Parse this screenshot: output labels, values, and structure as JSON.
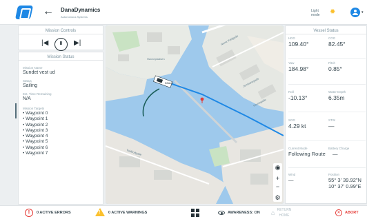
{
  "header": {
    "title": "DanaDynamics",
    "subtitle": "Autonomous Systems",
    "theme_label": "Light mode",
    "icons": {
      "logo": "logo-icon",
      "back": "arrow-left-icon",
      "theme": "sun-icon",
      "account": "account-circle-icon"
    }
  },
  "mission_controls": {
    "title": "Mission Controls",
    "icons": [
      "skip-previous-icon",
      "pause-icon",
      "skip-next-icon"
    ]
  },
  "mission_status": {
    "title": "Mission Status",
    "name_label": "Mission Name",
    "name_value": "Sundet vest ud",
    "status_label": "Status",
    "status_value": "Sailing",
    "time_label": "Est. Time Remaining",
    "time_value": "N/A",
    "targets_label": "Mission Targets",
    "targets": [
      "Waypoint 0",
      "Waypoint 1",
      "Waypoint 2",
      "Waypoint 3",
      "Waypoint 4",
      "Waypoint 5",
      "Waypoint 6",
      "Waypoint 7"
    ]
  },
  "map": {
    "vessel_label": "DNAC",
    "street_labels": [
      "Norre Voldgade",
      "Jernbanegade",
      "Havnepladsen",
      "Havnegade",
      "Toldbodgade"
    ],
    "controls": [
      "crosshair-icon",
      "zoom-in-icon",
      "zoom-out-icon",
      "settings-icon"
    ],
    "zoom_in": "+",
    "zoom_out": "−"
  },
  "vessel_status": {
    "title": "Vessel Status",
    "hdg_label": "HDG",
    "hdg_value": "109.40°",
    "cog_label": "COG",
    "cog_value": "82.45°",
    "yaw_label": "Yaw",
    "yaw_value": "184.98°",
    "pitch_label": "Pitch",
    "pitch_value": "0.85°",
    "roll_label": "Roll",
    "roll_value": "-10.13°",
    "depth_label": "Water Depth",
    "depth_value": "6.35m",
    "sog_label": "SOG",
    "sog_value": "4.29 kt",
    "stw_label": "STW",
    "stw_value": "—",
    "mode_label": "Current Mode",
    "mode_value": "Following Route",
    "battery_label": "Battery Charge",
    "battery_value": "—",
    "wind_label": "Wind",
    "wind_value": "—",
    "position_label": "Position",
    "position_lat": "55° 3' 39.92\"N",
    "position_lon": "10° 37' 0.99\"E"
  },
  "bottom_bar": {
    "errors": "0 ACTIVE ERRORS",
    "warnings": "0 ACTIVE WARNINGS",
    "awareness": "AWARENESS: ON",
    "return_home": "RETURN HOME",
    "abort": "ABORT",
    "colors": {
      "error": "#e53935",
      "warning": "#fbc02d",
      "accent": "#1e88e5"
    }
  }
}
